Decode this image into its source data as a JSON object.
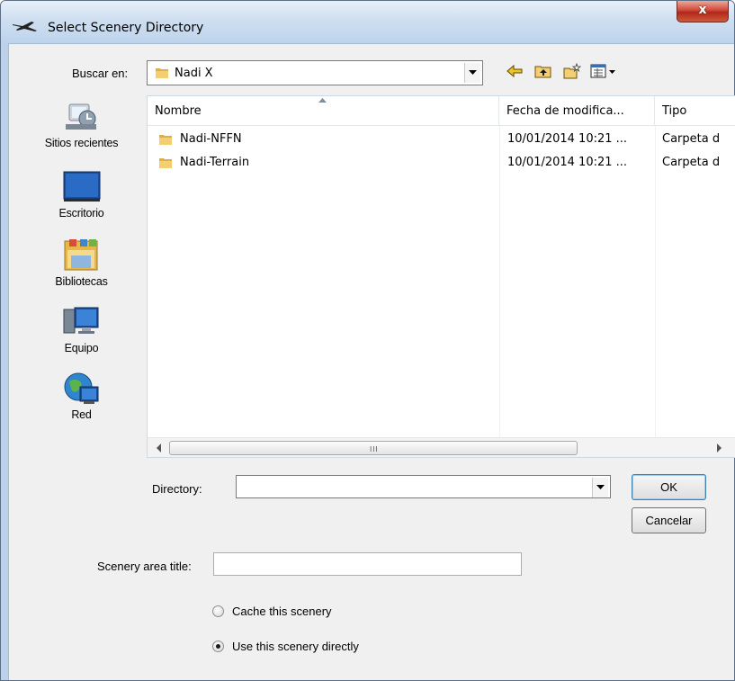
{
  "window": {
    "title": "Select Scenery Directory",
    "close_glyph": "x"
  },
  "lookin": {
    "label": "Buscar en:",
    "value": "Nadi X",
    "icon": "folder-icon"
  },
  "toolbar": {
    "icons": [
      "back-arrow-icon",
      "up-folder-icon",
      "new-folder-icon",
      "view-menu-icon"
    ]
  },
  "places": [
    {
      "label": "Sitios recientes",
      "icon": "recent-places-icon"
    },
    {
      "label": "Escritorio",
      "icon": "desktop-icon"
    },
    {
      "label": "Bibliotecas",
      "icon": "libraries-icon"
    },
    {
      "label": "Equipo",
      "icon": "computer-icon"
    },
    {
      "label": "Red",
      "icon": "network-icon"
    }
  ],
  "filelist": {
    "columns": [
      "Nombre",
      "Fecha de modifica...",
      "Tipo"
    ],
    "rows": [
      {
        "name": "Nadi-NFFN",
        "date": "10/01/2014 10:21 ...",
        "type": "Carpeta d"
      },
      {
        "name": "Nadi-Terrain",
        "date": "10/01/2014 10:21 ...",
        "type": "Carpeta d"
      }
    ],
    "scroll_grip": "III"
  },
  "directory": {
    "label": "Directory:",
    "value": ""
  },
  "buttons": {
    "ok": "OK",
    "cancel": "Cancelar"
  },
  "scenery_title": {
    "label": "Scenery area title:",
    "value": ""
  },
  "options": {
    "cache": "Cache this scenery",
    "direct": "Use this scenery directly",
    "selected": "direct"
  },
  "colors": {
    "frame": "#bcd2ea",
    "client": "#f0f0f0",
    "close": "#c4412f",
    "folder": "#e9c46a"
  }
}
